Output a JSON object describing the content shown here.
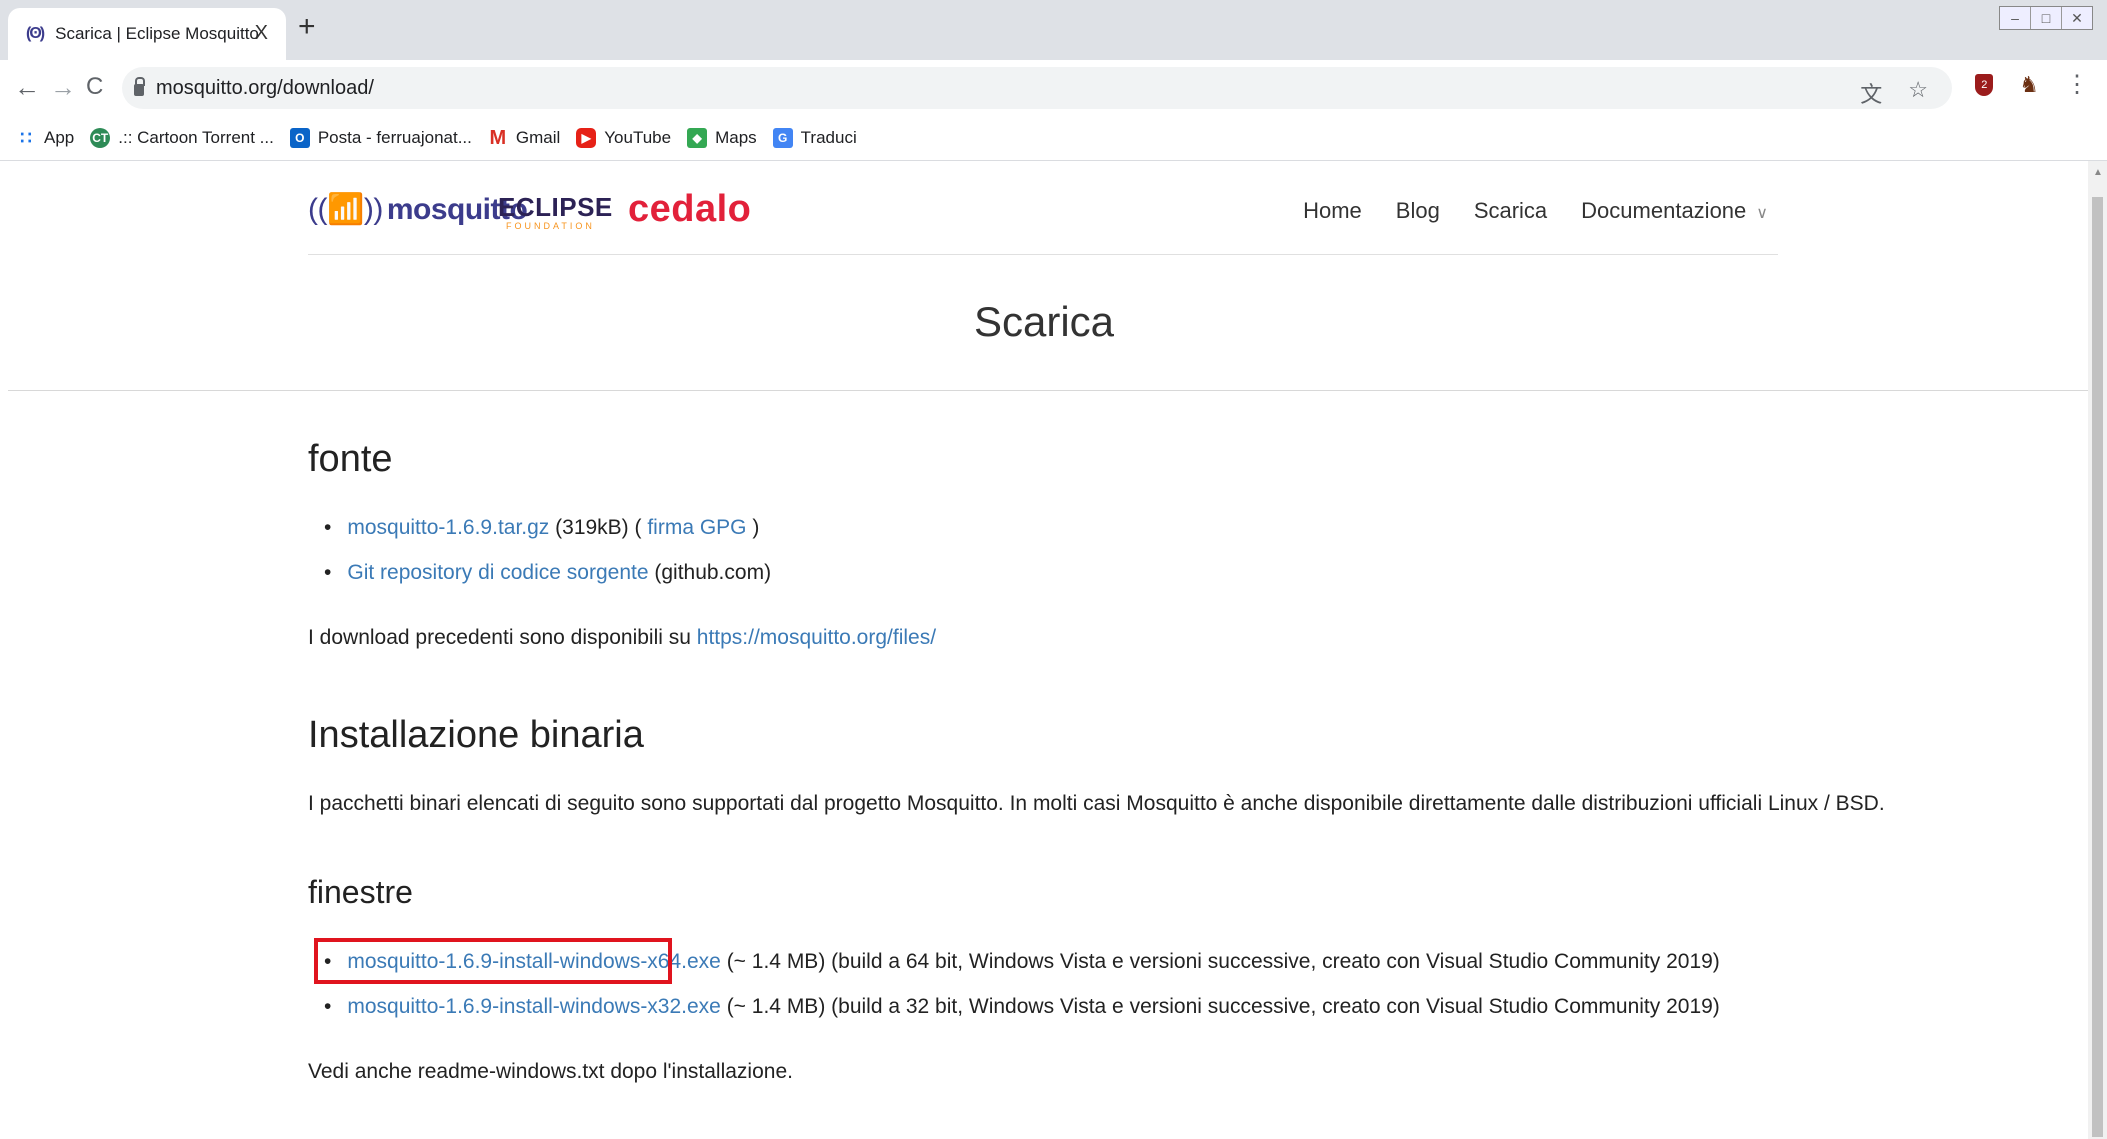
{
  "browser": {
    "tab_title": "Scarica | Eclipse Mosquitto",
    "tab_favicon": "(ʘ)",
    "tab_close": "X",
    "new_tab": "+",
    "url": "mosquitto.org/download/",
    "back": "←",
    "forward": "→",
    "reload": "C",
    "window_controls": [
      "–",
      "□",
      "✕"
    ],
    "bookmarks": [
      {
        "label": "App",
        "icon": "apps-grid-icon",
        "glyph": "∷"
      },
      {
        "label": ".:: Cartoon Torrent ...",
        "icon": "cartoon-torrent-icon",
        "glyph": "CT"
      },
      {
        "label": "Posta - ferruajonat...",
        "icon": "outlook-icon",
        "glyph": "O"
      },
      {
        "label": "Gmail",
        "icon": "gmail-icon",
        "glyph": "M"
      },
      {
        "label": "YouTube",
        "icon": "youtube-icon",
        "glyph": "▶"
      },
      {
        "label": "Maps",
        "icon": "maps-icon",
        "glyph": "◆"
      },
      {
        "label": "Traduci",
        "icon": "translate-icon",
        "glyph": "G"
      }
    ],
    "extension_badge": "2"
  },
  "site": {
    "logo_mosquitto": "mosquitto",
    "logo_eclipse": "ECLIPSE",
    "logo_eclipse_sub": "FOUNDATION",
    "logo_cedalo": "cedalo",
    "nav": [
      "Home",
      "Blog",
      "Scarica",
      "Documentazione"
    ]
  },
  "page": {
    "title": "Scarica",
    "fonte": {
      "heading": "fonte",
      "items": [
        {
          "link": "mosquitto-1.6.9.tar.gz",
          "text1": " (319kB) ( ",
          "link2": "firma GPG",
          "text2": " )"
        },
        {
          "link": "Git repository di codice sorgente",
          "text1": " (github.com)"
        }
      ],
      "older_text": "I download precedenti sono disponibili su ",
      "older_link": "https://mosquitto.org/files/"
    },
    "binary": {
      "heading": "Installazione binaria",
      "text": "I pacchetti binari elencati di seguito sono supportati dal progetto Mosquitto. In molti casi Mosquitto è anche disponibile direttamente dalle distribuzioni ufficiali Linux / BSD."
    },
    "windows": {
      "heading": "finestre",
      "items": [
        {
          "link": "mosquitto-1.6.9-install-windows-x64.exe",
          "text": " (~ 1.4 MB) (build a 64 bit, Windows Vista e versioni successive, creato con Visual Studio Community 2019)"
        },
        {
          "link": "mosquitto-1.6.9-install-windows-x32.exe",
          "text": " (~ 1.4 MB) (build a 32 bit, Windows Vista e versioni successive, creato con Visual Studio Community 2019)"
        }
      ],
      "note": "Vedi anche readme-windows.txt dopo l'installazione."
    }
  },
  "colors": {
    "link": "#3b7ab6",
    "highlight": "#e0141e",
    "cedalo": "#e2213a",
    "mosquitto": "#3c3c8c"
  }
}
